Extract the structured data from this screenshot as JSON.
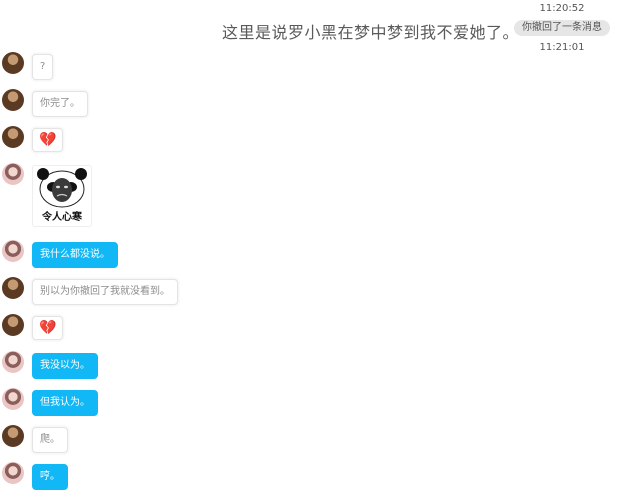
{
  "caption": "这里是说罗小黑在梦中梦到我不爱她了。",
  "system": {
    "time_1": "11:20:52",
    "recall_notice": "你撤回了一条消息",
    "time_2": "11:21:01"
  },
  "messages": [
    {
      "sender": "other",
      "kind": "text",
      "text": "?"
    },
    {
      "sender": "other",
      "kind": "text",
      "text": "你完了。"
    },
    {
      "sender": "other",
      "kind": "emoji",
      "text": "💔",
      "icon": "broken-heart-icon"
    },
    {
      "sender": "me",
      "kind": "sticker",
      "text": "令人心寒",
      "icon": "panda-meme-sticker"
    },
    {
      "sender": "me",
      "kind": "text",
      "text": "我什么都没说。"
    },
    {
      "sender": "other",
      "kind": "text",
      "text": "别以为你撤回了我就没看到。"
    },
    {
      "sender": "other",
      "kind": "emoji",
      "text": "💔",
      "icon": "broken-heart-icon"
    },
    {
      "sender": "me",
      "kind": "text",
      "text": "我没以为。"
    },
    {
      "sender": "me",
      "kind": "text",
      "text": "但我认为。"
    },
    {
      "sender": "other",
      "kind": "text",
      "text": "爬。"
    },
    {
      "sender": "me",
      "kind": "text",
      "text": "哼。"
    }
  ],
  "colors": {
    "my_bubble": "#12b7f5",
    "other_bubble": "#ffffff",
    "other_text": "#8c8c8c",
    "recall_pill": "#e6e6e6"
  }
}
